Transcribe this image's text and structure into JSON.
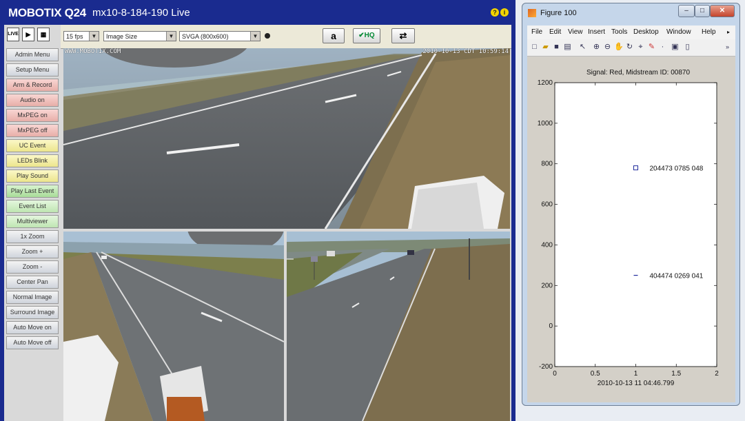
{
  "mobotix": {
    "brand": "MOBOTIX Q24",
    "camera": "mx10-8-184-190 Live",
    "help_glyph": "?",
    "info_glyph": "i",
    "icons": {
      "live": "LIVE",
      "play": "▶",
      "grid": "▦"
    },
    "toolbar": {
      "fps": "15 fps",
      "image_size": "Image Size",
      "resolution": "SVGA (800x600)",
      "lock_glyph": "a",
      "hq_label": "✔HQ",
      "export_glyph": "⇄"
    },
    "menu": [
      {
        "label": "Admin Menu",
        "style": "gray"
      },
      {
        "label": "Setup Menu",
        "style": "gray"
      },
      {
        "label": "Arm & Record",
        "style": "red"
      },
      {
        "label": "Audio on",
        "style": "red"
      },
      {
        "label": "MxPEG on",
        "style": "red"
      },
      {
        "label": "MxPEG off",
        "style": "red"
      },
      {
        "label": "UC Event",
        "style": "yellow"
      },
      {
        "label": "LEDs Blink",
        "style": "yellow"
      },
      {
        "label": "Play Sound",
        "style": "yellow"
      },
      {
        "label": "Play Last Event",
        "style": "green"
      },
      {
        "label": "Event List",
        "style": "lgreen"
      },
      {
        "label": "Multiviewer",
        "style": "lgreen"
      },
      {
        "label": "1x Zoom",
        "style": "gray"
      },
      {
        "label": "Zoom +",
        "style": "gray"
      },
      {
        "label": "Zoom -",
        "style": "gray"
      },
      {
        "label": "Center Pan",
        "style": "gray"
      },
      {
        "label": "Normal Image",
        "style": "gray"
      },
      {
        "label": "Surround Image",
        "style": "gray"
      },
      {
        "label": "Auto Move on",
        "style": "gray"
      },
      {
        "label": "Auto Move off",
        "style": "gray"
      }
    ],
    "overlay_left": "WWW.MOBOTIX.COM",
    "overlay_right": "2010-10-13 CDT 10:59:14"
  },
  "figure": {
    "title": "Figure 100",
    "window_buttons": {
      "minimize": "–",
      "maximize": "□",
      "close": "✕"
    },
    "menus": [
      "File",
      "Edit",
      "View",
      "Insert",
      "Tools",
      "Desktop",
      "Window",
      "Help"
    ],
    "menu_overflow": "▸",
    "toolbar_overflow": "»"
  },
  "chart_data": {
    "type": "scatter",
    "title": "Signal: Red, Midstream ID: 00870",
    "xlabel": "2010-10-13 11 04:46.799",
    "ylabel": "",
    "xlim": [
      0,
      2
    ],
    "ylim": [
      -200,
      1200
    ],
    "xticks": [
      "0",
      "0.5",
      "1",
      "1.5",
      "2"
    ],
    "yticks": [
      "-200",
      "0",
      "200",
      "400",
      "600",
      "800",
      "1000",
      "1200"
    ],
    "ytick_values": [
      -200,
      0,
      200,
      400,
      600,
      800,
      1000,
      1200
    ],
    "xtick_values": [
      0,
      0.5,
      1,
      1.5,
      2
    ],
    "points": [
      {
        "x": 1,
        "y": 780,
        "marker": "square",
        "label": "204473 0785 048"
      },
      {
        "x": 1,
        "y": 250,
        "marker": "dash",
        "label": "404474 0269 041"
      }
    ],
    "marker_color": "#1f2a9c",
    "grid": false
  }
}
